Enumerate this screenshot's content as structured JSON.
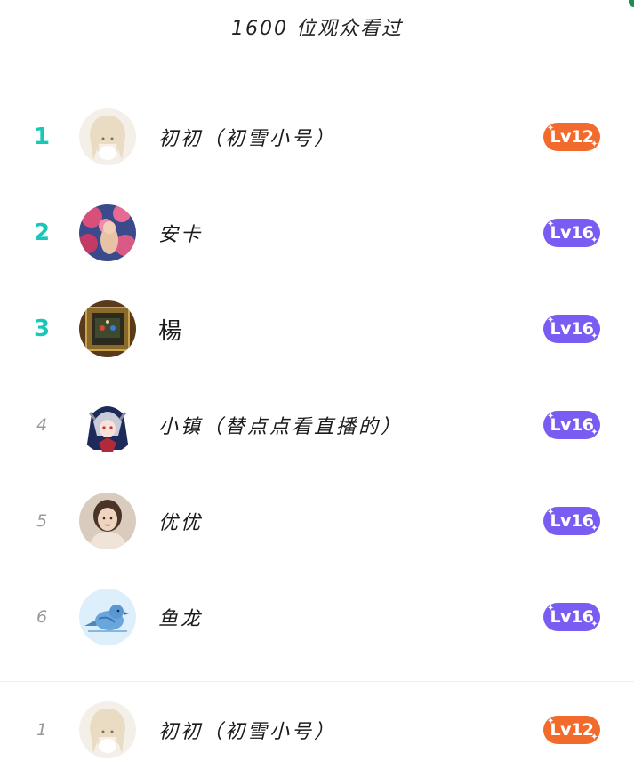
{
  "header": {
    "title": "1600 位观众看过"
  },
  "colors": {
    "rank_top": "#19c7b6",
    "rank_plain": "#9a9a9a",
    "badge_orange": "#f36b2c",
    "badge_purple": "#7a5cf2"
  },
  "viewers": [
    {
      "rank": "1",
      "name": "初初（初雪小号）",
      "level": "Lv12",
      "badge_color": "orange",
      "avatar_icon": "anime-girl-avatar"
    },
    {
      "rank": "2",
      "name": "安卡",
      "level": "Lv16",
      "badge_color": "purple",
      "avatar_icon": "pink-flowers-avatar"
    },
    {
      "rank": "3",
      "name": "楊",
      "level": "Lv16",
      "badge_color": "purple",
      "avatar_icon": "framed-picture-avatar"
    },
    {
      "rank": "4",
      "name": "小镇（替点点看直播的）",
      "level": "Lv16",
      "badge_color": "purple",
      "avatar_icon": "anime-character-avatar"
    },
    {
      "rank": "5",
      "name": "优优",
      "level": "Lv16",
      "badge_color": "purple",
      "avatar_icon": "woman-portrait-avatar"
    },
    {
      "rank": "6",
      "name": "鱼龙",
      "level": "Lv16",
      "badge_color": "purple",
      "avatar_icon": "blue-bird-avatar"
    }
  ],
  "self": {
    "rank": "1",
    "name": "初初（初雪小号）",
    "level": "Lv12",
    "badge_color": "orange",
    "avatar_icon": "anime-girl-avatar"
  }
}
